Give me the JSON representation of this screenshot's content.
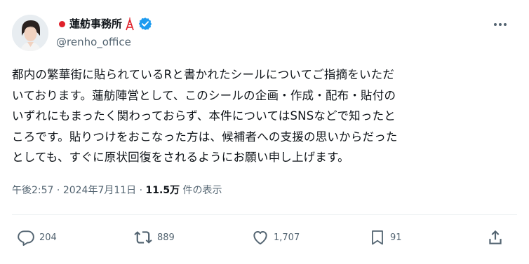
{
  "author": {
    "display_name": "蓮舫事務所",
    "handle": "@renho_office",
    "verified": true,
    "badges": [
      "red-circle-icon",
      "tokyo-tower-icon",
      "verified-icon"
    ]
  },
  "post": {
    "text": "都内の繁華街に貼られているRと書かれたシールについてご指摘をいただ\nいております。蓮舫陣営として、このシールの企画・作成・配布・貼付の\nいずれにもまったく関わっておらず、本件についてはSNSなどで知ったと\nころです。貼りつけをおこなった方は、候補者への支援の思いからだった\nとしても、すぐに原状回復をされるようにお願い申し上げます。",
    "time": "午後2:57",
    "separator": "·",
    "date": "2024年7月11日",
    "views": "11.5万",
    "views_suffix": "件の表示"
  },
  "actions": {
    "reply_count": "204",
    "repost_count": "889",
    "like_count": "1,707",
    "bookmark_count": "91"
  },
  "colors": {
    "text": "#0f1419",
    "secondary": "#536471",
    "verified": "#1d9bf0",
    "flag_red": "#e0202a"
  }
}
